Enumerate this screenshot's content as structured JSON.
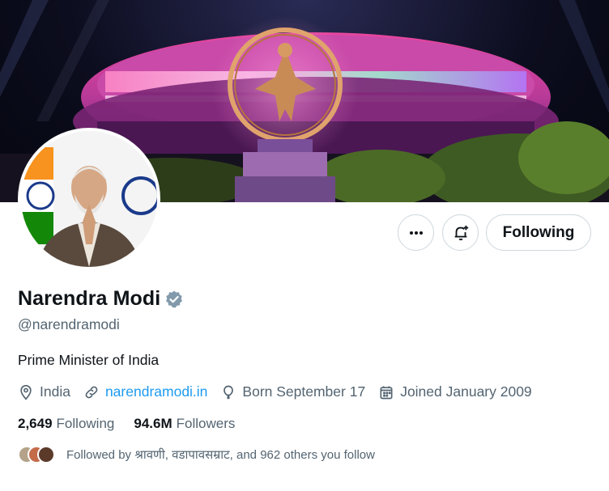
{
  "profile": {
    "name": "Narendra Modi",
    "handle": "@narendramodi",
    "bio": "Prime Minister of India",
    "location": "India",
    "website": "narendramodi.in",
    "birthday": "Born September 17",
    "joined": "Joined January 2009",
    "following_count": "2,649",
    "following_label": "Following",
    "followers_count": "94.6M",
    "followers_label": "Followers",
    "followed_by": "Followed by श्रावणी, वडापावसम्राट, and 962 others you follow"
  },
  "actions": {
    "more_icon": "more-horizontal-icon",
    "notify_icon": "bell-plus-icon",
    "following_label": "Following"
  },
  "icons": {
    "location": "location-pin-icon",
    "website": "link-icon",
    "birthday": "balloon-icon",
    "joined": "calendar-icon",
    "verified": "verified-badge-icon"
  },
  "colors": {
    "accent": "#1d9bf0",
    "verified": "#829aab",
    "text_primary": "#0f1419",
    "text_secondary": "#536471"
  }
}
